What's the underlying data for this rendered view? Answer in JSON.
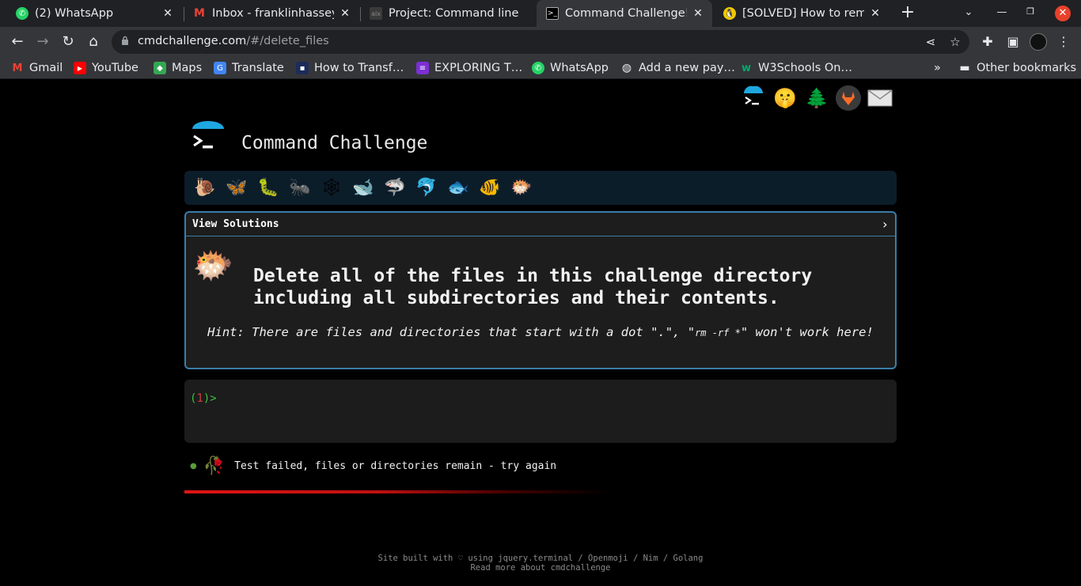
{
  "browser": {
    "tabs": [
      {
        "title": "(2) WhatsApp",
        "icon": "whatsapp-icon",
        "color": "#25d366",
        "active": false
      },
      {
        "title": "Inbox - franklinhassey@",
        "icon": "gmail-icon",
        "color": "#ea4335",
        "active": false
      },
      {
        "title": "Project: Command line",
        "icon": "project-icon",
        "color": "#444444",
        "active": false
      },
      {
        "title": "Command Challenge!",
        "icon": "terminal-icon",
        "color": "#1a1a1a",
        "active": true
      },
      {
        "title": "[SOLVED] How to remo",
        "icon": "linux-icon",
        "color": "#f0c800",
        "active": false
      }
    ],
    "url_host": "cmdchallenge.com",
    "url_path": "/#/delete_files",
    "bookmarks": [
      {
        "label": "Gmail",
        "icon": "gmail-icon",
        "color": "#ea4335"
      },
      {
        "label": "YouTube",
        "icon": "youtube-icon",
        "color": "#ff0000"
      },
      {
        "label": "Maps",
        "icon": "maps-icon",
        "color": "#34a853"
      },
      {
        "label": "Translate",
        "icon": "translate-icon",
        "color": "#4285f4"
      },
      {
        "label": "How to Transf…",
        "icon": "doc-icon",
        "color": "#1c2b5a"
      },
      {
        "label": "EXPLORING T…",
        "icon": "list-icon",
        "color": "#7b2fd4"
      },
      {
        "label": "WhatsApp",
        "icon": "whatsapp-icon",
        "color": "#25d366"
      },
      {
        "label": "Add a new pay…",
        "icon": "globe-icon",
        "color": "#5f6368"
      },
      {
        "label": "W3Schools On…",
        "icon": "w3schools-icon",
        "color": "#04aa6d"
      }
    ],
    "overflow_label": "»",
    "other_bookmarks": "Other bookmarks"
  },
  "page": {
    "site_title": "Command Challenge",
    "view_solutions": "View Solutions",
    "challenge_line1": "Delete all of the files in this challenge directory",
    "challenge_line2": "including all subdirectories and their contents.",
    "hint_prefix": "Hint: There are files and directories that start with a dot \".\", \"",
    "hint_code": "rm -rf *",
    "hint_suffix": "\" won't work here!",
    "prompt_open": "(",
    "prompt_num": "1",
    "prompt_close": ")>",
    "status_message": "Test failed, files or directories remain - try again",
    "progress": 0.4,
    "footer_line1": "Site built with ♡ using jquery.terminal / Openmoji / Nim / Golang",
    "footer_line2": "Read more about cmdchallenge",
    "animals": [
      "snail-icon",
      "butterfly-icon",
      "caterpillar-icon",
      "ant-icon",
      "spider-web-icon",
      "whale-icon",
      "shark-icon",
      "dolphin-icon",
      "fish-icon",
      "tropical-fish-icon",
      "blowfish-icon"
    ]
  },
  "colors": {
    "panel_border": "#3a7ea8",
    "prompt_green": "#3fbf3f",
    "prompt_red": "#d23c3c",
    "progress_red": "#e01414"
  }
}
